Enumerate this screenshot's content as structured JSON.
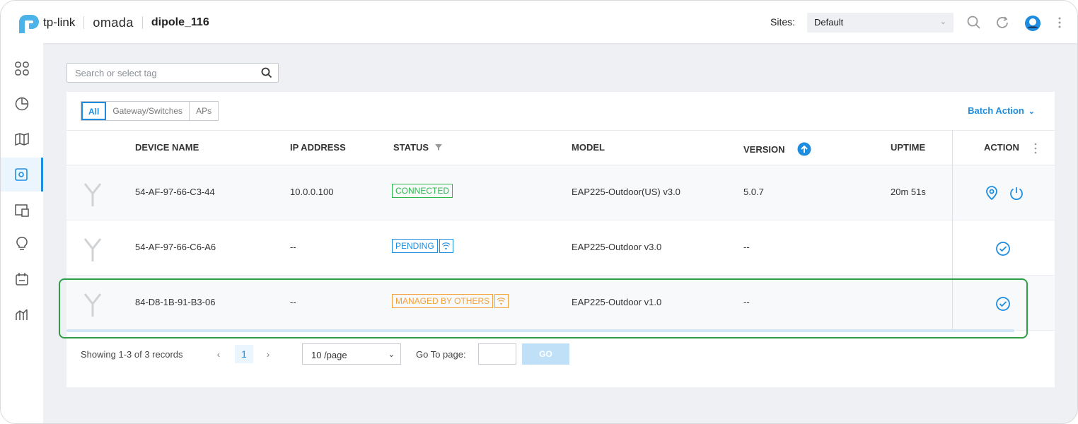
{
  "header": {
    "brand": "tp-link",
    "product": "omada",
    "controller_name": "dipole_116",
    "sites_label": "Sites:",
    "site_selected": "Default"
  },
  "search": {
    "placeholder": "Search or select tag"
  },
  "filter_tabs": [
    "All",
    "Gateway/Switches",
    "APs"
  ],
  "active_tab": "All",
  "batch_action": "Batch Action",
  "table": {
    "columns": [
      "DEVICE NAME",
      "IP ADDRESS",
      "STATUS",
      "MODEL",
      "VERSION",
      "UPTIME",
      "ACTION"
    ],
    "rows": [
      {
        "device_name": "54-AF-97-66-C3-44",
        "ip": "10.0.0.100",
        "status": "CONNECTED",
        "model": "EAP225-Outdoor(US) v3.0",
        "version": "5.0.7",
        "uptime": "20m 51s"
      },
      {
        "device_name": "54-AF-97-66-C6-A6",
        "ip": "--",
        "status": "PENDING",
        "model": "EAP225-Outdoor v3.0",
        "version": "--",
        "uptime": ""
      },
      {
        "device_name": "84-D8-1B-91-B3-06",
        "ip": "--",
        "status": "MANAGED BY OTHERS",
        "model": "EAP225-Outdoor v1.0",
        "version": "--",
        "uptime": ""
      }
    ]
  },
  "pagination": {
    "summary": "Showing 1-3 of 3 records",
    "current_page": "1",
    "per_page": "10 /page",
    "goto_label": "Go To page:",
    "go_button": "GO"
  },
  "colors": {
    "accent": "#1e8de0",
    "connected": "#2db84d",
    "pending": "#1e8de0",
    "managed_by_others": "#f5a03c",
    "highlight_border": "#2e9e47"
  }
}
